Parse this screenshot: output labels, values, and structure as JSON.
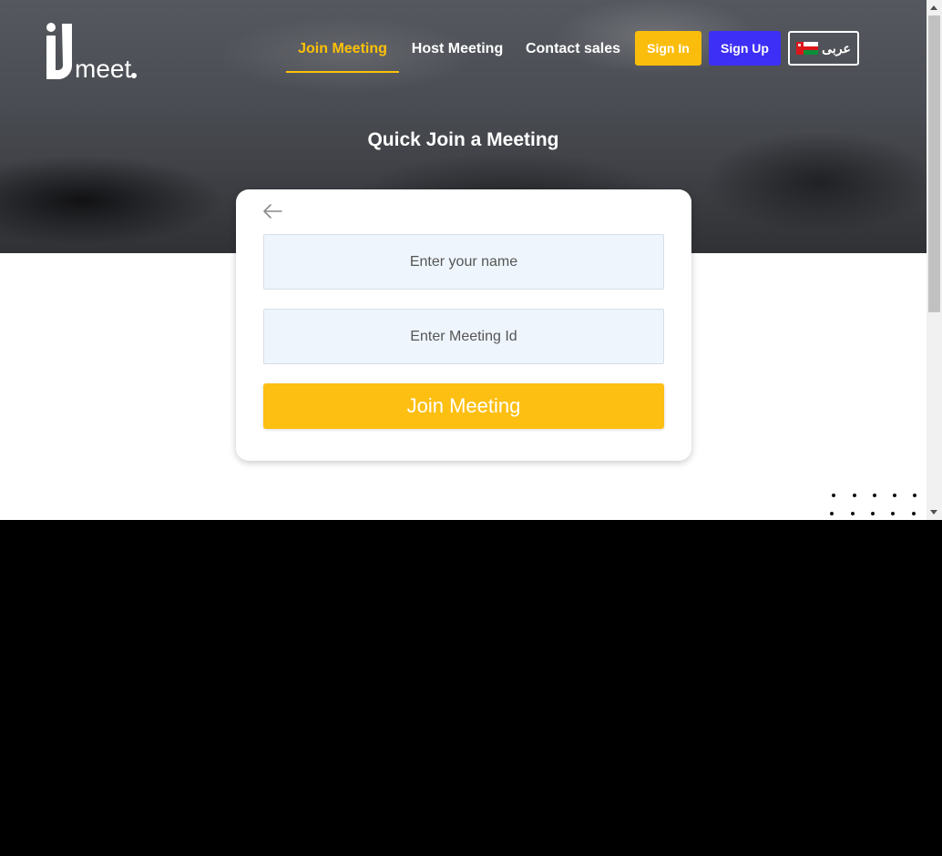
{
  "brand": {
    "logo_text": "iJmeet"
  },
  "nav": {
    "join_meeting": "Join Meeting",
    "host_meeting": "Host Meeting",
    "contact_sales": "Contact sales",
    "sign_in": "Sign In",
    "sign_up": "Sign Up",
    "language": "عربى"
  },
  "page": {
    "heading": "Quick Join a Meeting"
  },
  "form": {
    "name_placeholder": "Enter your name",
    "meeting_id_placeholder": "Enter Meeting Id",
    "submit_label": "Join Meeting"
  },
  "colors": {
    "accent": "#ffc107",
    "join_button": "#fdbf12",
    "sign_up": "#3d2ff5",
    "input_bg": "#eef5fd"
  },
  "icons": {
    "back": "arrow-left-icon",
    "flag": "oman-flag-icon",
    "dots": "dot-pattern"
  }
}
